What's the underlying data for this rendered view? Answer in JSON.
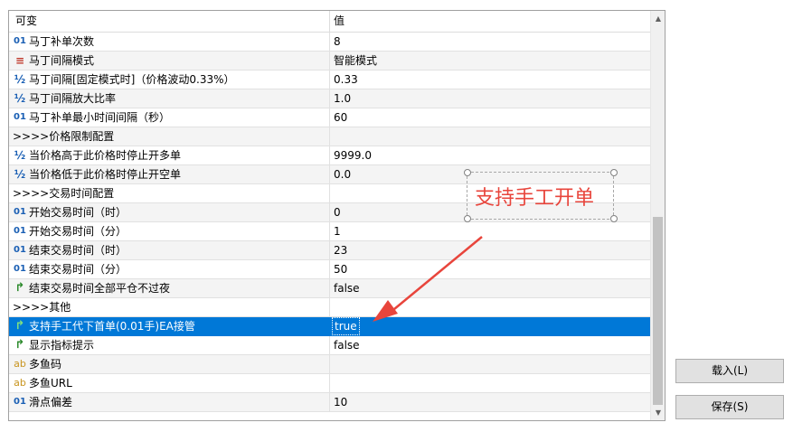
{
  "grid": {
    "headers": {
      "name": "可变",
      "value": "值"
    },
    "rows": [
      {
        "icon": "01",
        "kind": "int",
        "name": "马丁补单次数",
        "value": "8"
      },
      {
        "icon": "≡",
        "kind": "enum",
        "name": "马丁间隔模式",
        "value": "智能模式"
      },
      {
        "icon": "½",
        "kind": "double",
        "name": "马丁间隔[固定模式时]（价格波动0.33%）",
        "value": "0.33"
      },
      {
        "icon": "½",
        "kind": "double",
        "name": "马丁间隔放大比率",
        "value": "1.0"
      },
      {
        "icon": "01",
        "kind": "int",
        "name": "马丁补单最小时间间隔（秒）",
        "value": "60"
      },
      {
        "icon": "",
        "kind": "group",
        "name": ">>>>价格限制配置",
        "value": ""
      },
      {
        "icon": "½",
        "kind": "double",
        "name": "当价格高于此价格时停止开多单",
        "value": "9999.0"
      },
      {
        "icon": "½",
        "kind": "double",
        "name": "当价格低于此价格时停止开空单",
        "value": "0.0"
      },
      {
        "icon": "",
        "kind": "group",
        "name": ">>>>交易时间配置",
        "value": ""
      },
      {
        "icon": "01",
        "kind": "int",
        "name": "开始交易时间（时）",
        "value": "0"
      },
      {
        "icon": "01",
        "kind": "int",
        "name": "开始交易时间（分）",
        "value": "1"
      },
      {
        "icon": "01",
        "kind": "int",
        "name": "结束交易时间（时）",
        "value": "23"
      },
      {
        "icon": "01",
        "kind": "int",
        "name": "结束交易时间（分）",
        "value": "50"
      },
      {
        "icon": "↱",
        "kind": "bool",
        "name": "结束交易时间全部平仓不过夜",
        "value": "false"
      },
      {
        "icon": "",
        "kind": "group",
        "name": ">>>>其他",
        "value": ""
      },
      {
        "icon": "↱",
        "kind": "bool",
        "name": "支持手工代下首单(0.01手)EA接管",
        "value": "true",
        "selected": true
      },
      {
        "icon": "↱",
        "kind": "bool",
        "name": "显示指标提示",
        "value": "false"
      },
      {
        "icon": "ab",
        "kind": "string",
        "name": "多鱼码",
        "value": ""
      },
      {
        "icon": "ab",
        "kind": "string",
        "name": "多鱼URL",
        "value": ""
      },
      {
        "icon": "01",
        "kind": "int",
        "name": "滑点偏差",
        "value": "10"
      }
    ]
  },
  "scrollbar": {
    "up_icon": "chevron-up-icon",
    "down_icon": "chevron-down-icon"
  },
  "buttons": {
    "load": "载入(L)",
    "save": "保存(S)"
  },
  "annotation": {
    "text": "支持手工开单",
    "color": "#e8453c"
  },
  "colors": {
    "selection": "#0078d7",
    "alt_row": "#f4f4f4"
  }
}
